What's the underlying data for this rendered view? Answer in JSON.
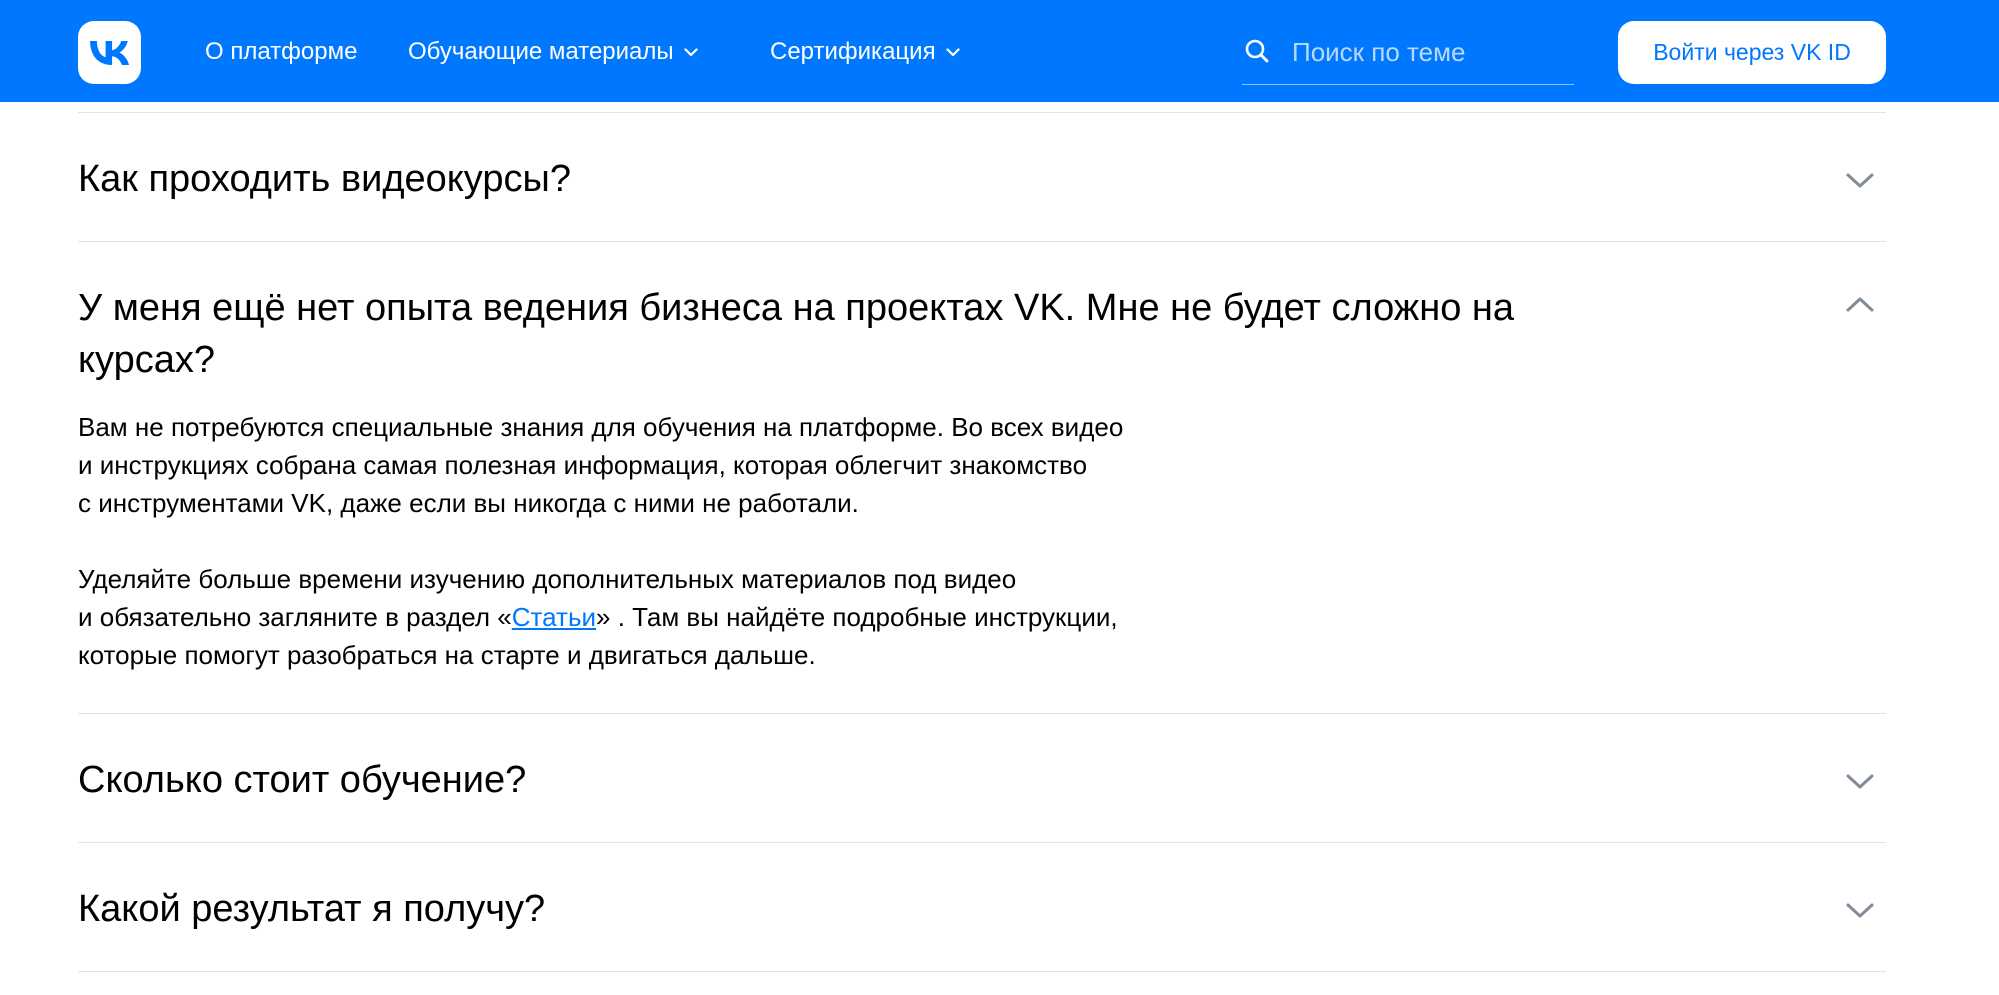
{
  "header": {
    "logo_icon": "vk-logo-icon",
    "nav": [
      {
        "label": "О платформе",
        "has_dropdown": false
      },
      {
        "label": "Обучающие материалы",
        "has_dropdown": true
      },
      {
        "label": "Сертификация",
        "has_dropdown": true
      }
    ],
    "search": {
      "placeholder": "Поиск по теме",
      "value": "",
      "icon": "search-icon"
    },
    "login_label": "Войти через VK ID",
    "accent_color": "#0077ff"
  },
  "faq": [
    {
      "question": "Как проходить видеокурсы?",
      "expanded": false,
      "icon": "chevron-down-icon"
    },
    {
      "question": "У меня ещё нет опыта ведения бизнеса на проектах VK. Мне не будет сложно на курсах?",
      "expanded": true,
      "icon": "chevron-up-icon",
      "answer": {
        "p1": [
          "Вам не потребуются специальные знания для обучения на платформе. Во всех видео",
          "и инструкциях собрана самая полезная информация, которая облегчит знакомство",
          "с инструментами VK, даже если вы никогда с ними не работали."
        ],
        "p2_line1": "Уделяйте больше времени изучению дополнительных материалов под видео",
        "p2_line2_before": "и обязательно загляните в раздел «",
        "p2_link": "Статьи",
        "p2_line2_after": "» . Там вы найдёте подробные инструкции,",
        "p2_line3": "которые помогут разобраться на старте и двигаться дальше."
      }
    },
    {
      "question": "Сколько стоит обучение?",
      "expanded": false,
      "icon": "chevron-down-icon"
    },
    {
      "question": "Какой результат я получу?",
      "expanded": false,
      "icon": "chevron-down-icon"
    }
  ]
}
